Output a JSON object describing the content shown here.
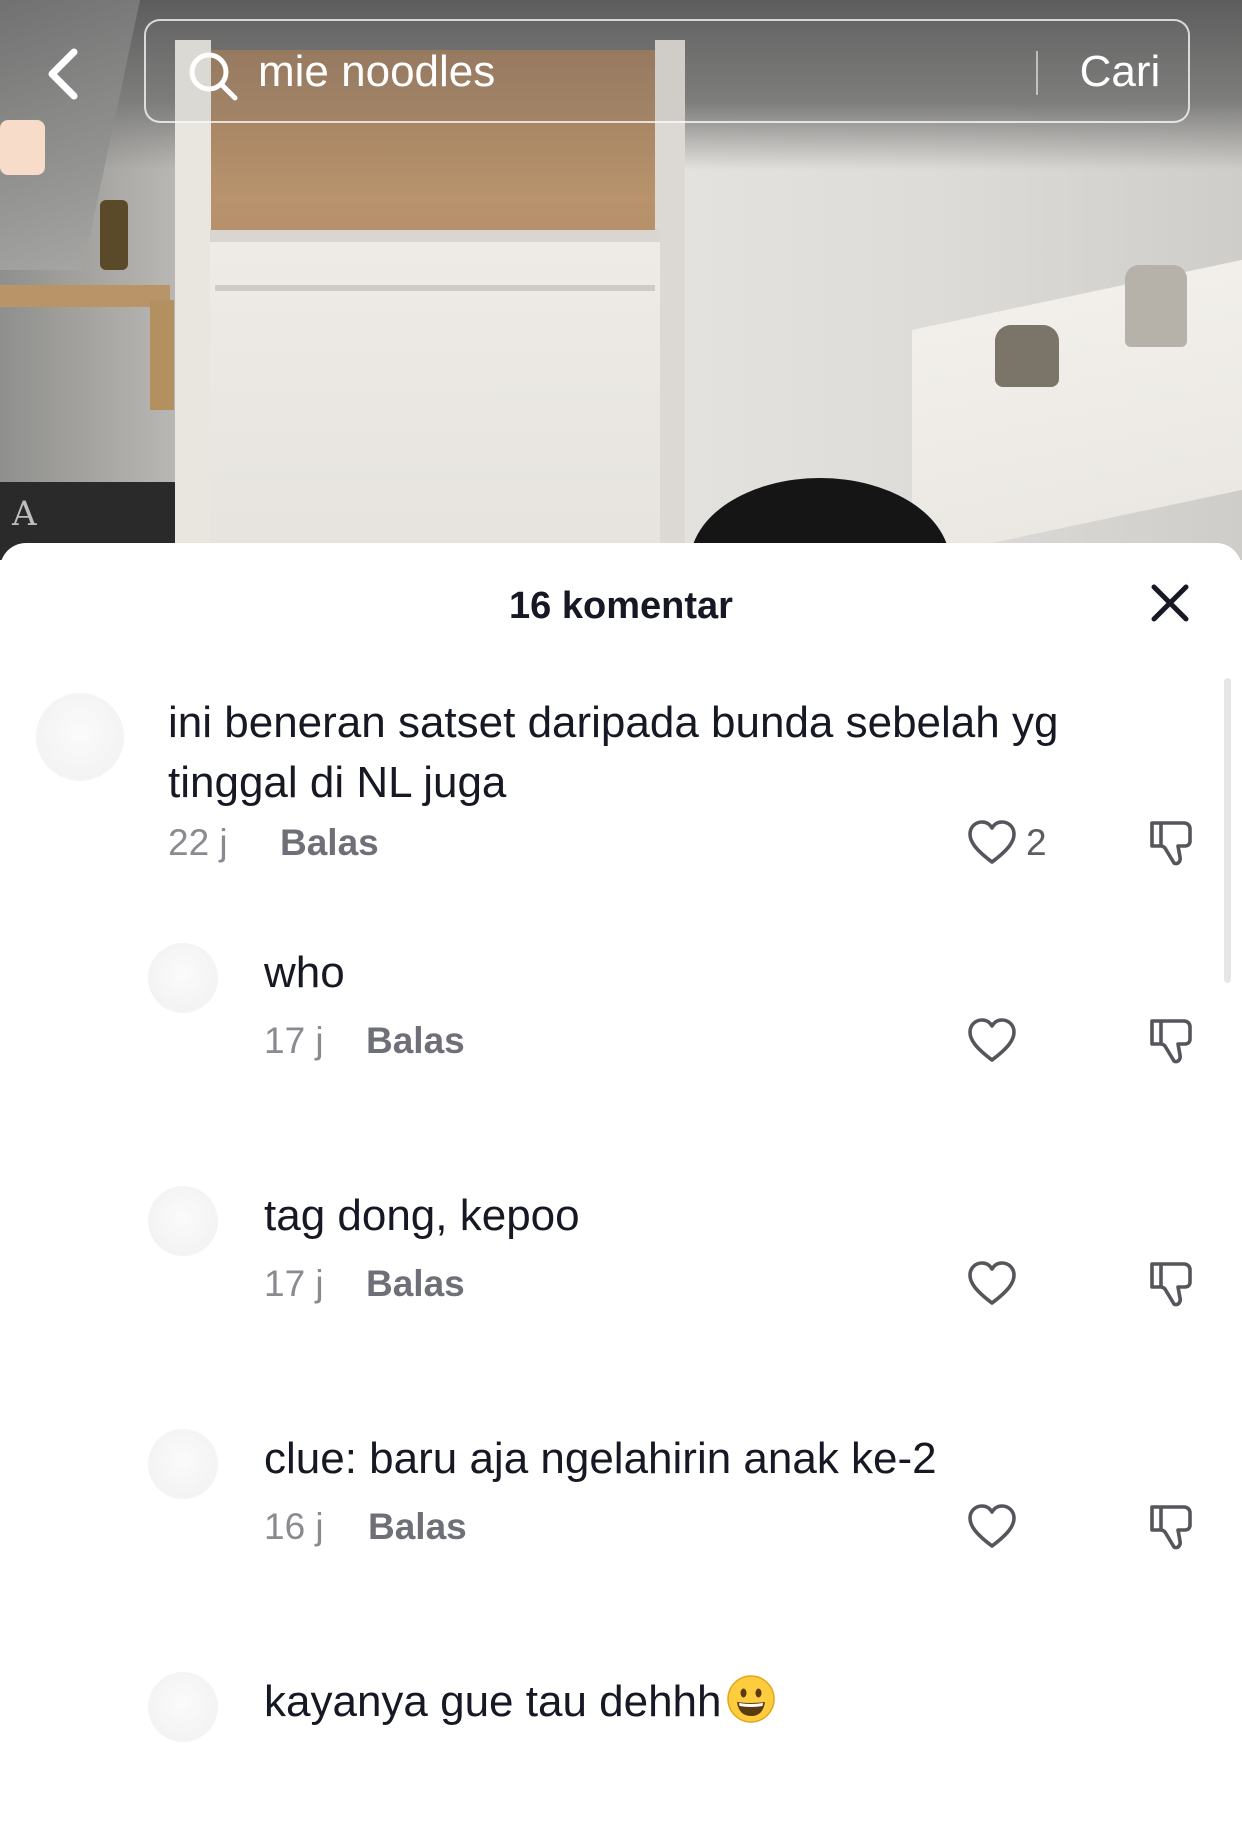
{
  "search": {
    "query": "mie noodles",
    "submit_label": "Cari"
  },
  "video_background": {
    "wall_letter": "A"
  },
  "comments_panel": {
    "title": "16 komentar",
    "comments": [
      {
        "text": "ini beneran satset daripada bunda sebelah yg tinggal di NL juga",
        "time": "22 j",
        "reply_label": "Balas",
        "likes": "2"
      },
      {
        "text": "who",
        "time": "17 j",
        "reply_label": "Balas",
        "likes": ""
      },
      {
        "text": "tag dong, kepoo",
        "time": "17 j",
        "reply_label": "Balas",
        "likes": ""
      },
      {
        "text": "clue: baru aja ngelahirin anak ke-2",
        "time": "16 j",
        "reply_label": "Balas",
        "likes": ""
      },
      {
        "text": "kayanya gue tau dehhh",
        "emoji": "grinning-face-emoji"
      }
    ]
  },
  "colors": {
    "text_primary": "#161823",
    "text_secondary": "#8a8b91",
    "icon_stroke": "#55565c"
  }
}
